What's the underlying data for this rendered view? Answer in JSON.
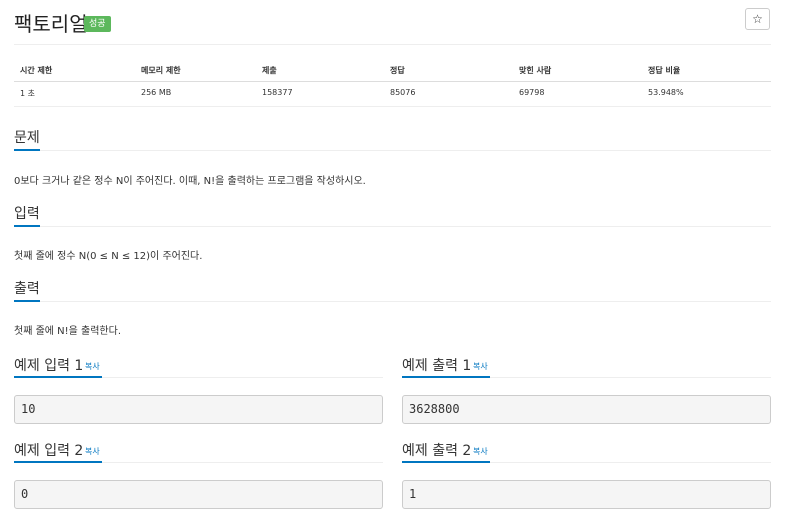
{
  "problem": {
    "title": "팩토리얼",
    "status_badge": "성공",
    "star_icon": "☆"
  },
  "stats": {
    "headers": [
      "시간 제한",
      "메모리 제한",
      "제출",
      "정답",
      "맞힌 사람",
      "정답 비율"
    ],
    "values": [
      "1 초",
      "256 MB",
      "158377",
      "85076",
      "69798",
      "53.948%"
    ]
  },
  "sections": {
    "description": {
      "heading": "문제",
      "text": "0보다 크거나 같은 정수 N이 주어진다. 이때, N!을 출력하는 프로그램을 작성하시오."
    },
    "input": {
      "heading": "입력",
      "text": "첫째 줄에 정수 N(0 ≤ N ≤ 12)이 주어진다."
    },
    "output": {
      "heading": "출력",
      "text": "첫째 줄에 N!을 출력한다."
    }
  },
  "samples": {
    "copy_label": "복사",
    "input1_heading": "예제 입력 1",
    "output1_heading": "예제 출력 1",
    "input1_value": "10",
    "output1_value": "3628800",
    "input2_heading": "예제 입력 2",
    "output2_heading": "예제 출력 2",
    "input2_value": "0",
    "output2_value": "1"
  }
}
